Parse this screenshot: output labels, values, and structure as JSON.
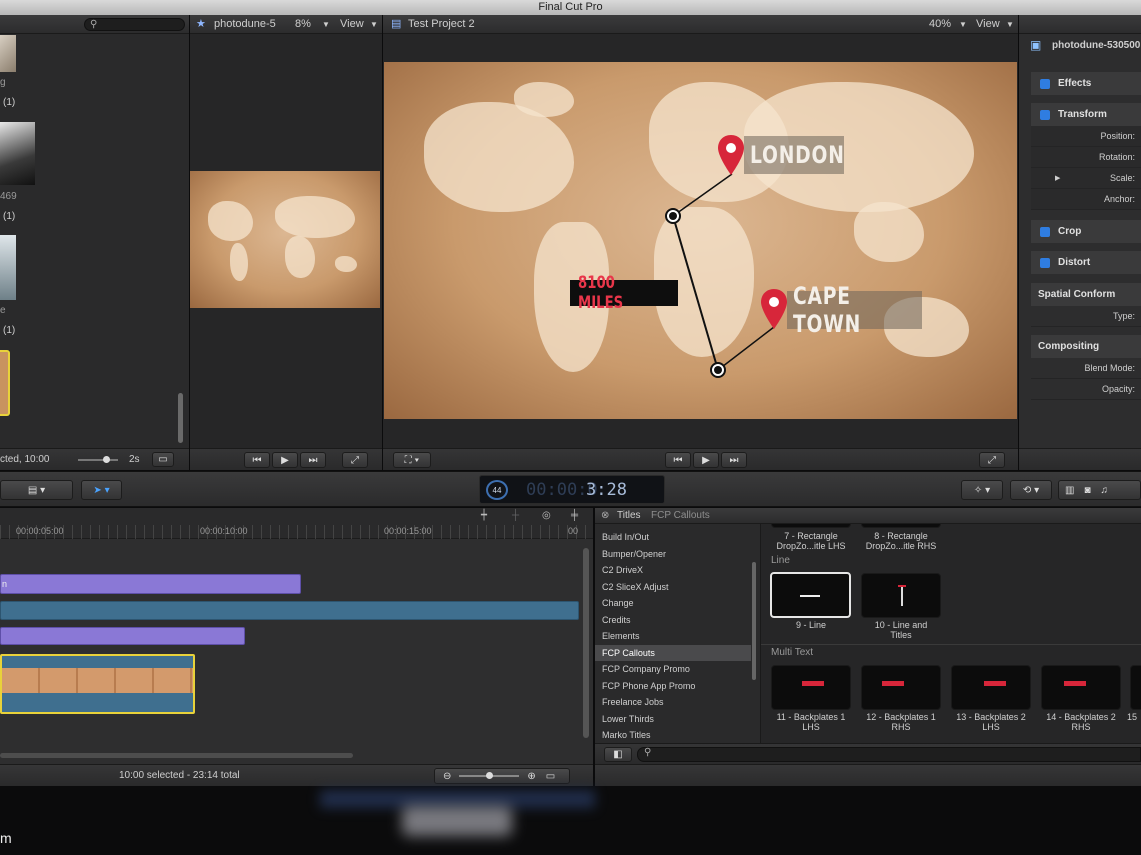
{
  "app_title": "Final Cut Pro",
  "browser": {
    "clip_labels": [
      "g",
      "(1)",
      "469",
      "(1)",
      "e",
      "(1)"
    ],
    "status": "cted, 10:00",
    "duration": "2s"
  },
  "event_viewer": {
    "clip_name": "photodune-5",
    "zoom": "8%",
    "view_label": "View"
  },
  "main_viewer": {
    "project_name": "Test Project 2",
    "zoom": "40%",
    "view_label": "View",
    "callouts": {
      "london": "LONDON",
      "cape_town": "CAPE TOWN",
      "distance": "8100 MILES"
    }
  },
  "inspector": {
    "clip_name": "photodune-530500",
    "sections": {
      "effects": "Effects",
      "transform": "Transform",
      "crop": "Crop",
      "distort": "Distort",
      "spatial_conform": "Spatial Conform",
      "compositing": "Compositing"
    },
    "transform_props": [
      "Position:",
      "Rotation:",
      "Scale:",
      "Anchor:"
    ],
    "spatial_type": "Type:",
    "compositing_props": [
      "Blend Mode:",
      "Opacity:"
    ]
  },
  "dashboard": {
    "timecode_dim": "00:00:0",
    "timecode_bright": "3:28",
    "badge": "44"
  },
  "timeline": {
    "ruler": [
      "00:00:05:00",
      "00:00:10:00",
      "00:00:15:00",
      "00"
    ],
    "clip_label": "n",
    "status": "10:00 selected - 23:14 total"
  },
  "titles_browser": {
    "header": "Titles",
    "subheader": "FCP Callouts",
    "categories": [
      "Build In/Out",
      "Bumper/Opener",
      "C2 DriveX",
      "C2 SliceX Adjust",
      "Change",
      "Credits",
      "Elements",
      "FCP Callouts",
      "FCP Company Promo",
      "FCP Phone App Promo",
      "Freelance Jobs",
      "Lower Thirds",
      "Marko Titles"
    ],
    "selected_category": "FCP Callouts",
    "top_captions": [
      [
        "7 - Rectangle",
        "DropZo...itle LHS"
      ],
      [
        "8 - Rectangle",
        "DropZo...itle RHS"
      ]
    ],
    "line_section": "Line",
    "line_items": [
      [
        "9 - Line",
        ""
      ],
      [
        "10 - Line and",
        "Titles"
      ]
    ],
    "multi_section": "Multi Text",
    "multi_items": [
      [
        "11 - Backplates 1",
        "LHS"
      ],
      [
        "12 - Backplates 1",
        "RHS"
      ],
      [
        "13 - Backplates 2",
        "LHS"
      ],
      [
        "14 - Backplates 2",
        "RHS"
      ],
      [
        "15",
        ""
      ]
    ]
  },
  "bottom_left_text": "m",
  "colors": {
    "accent_blue": "#2f7de1",
    "callout_red": "#d7263a",
    "clip_purple": "#8a78d6",
    "clip_teal": "#3f6f8f",
    "selection_yellow": "#e8d23a"
  }
}
